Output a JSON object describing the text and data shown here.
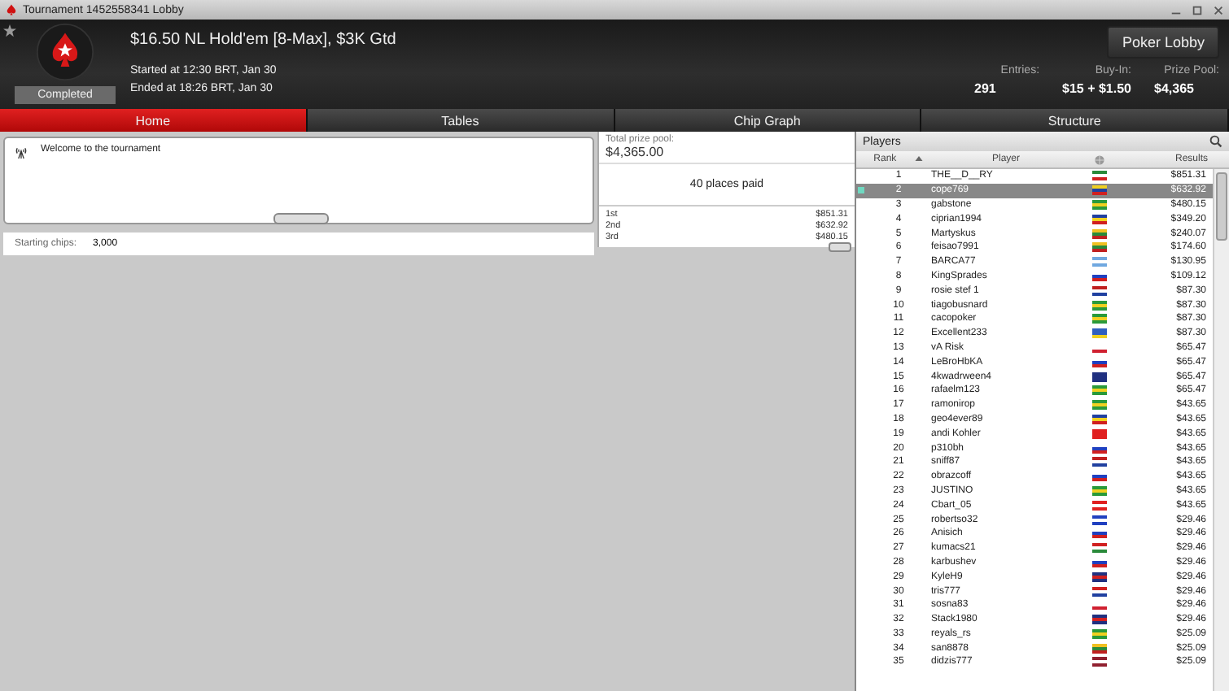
{
  "window": {
    "title": "Tournament 1452558341 Lobby"
  },
  "header": {
    "title": "$16.50 NL Hold'em [8-Max], $3K Gtd",
    "status": "Completed",
    "started": "Started at 12:30 BRT, Jan 30",
    "ended": "Ended at 18:26 BRT, Jan 30",
    "lobby_button": "Poker Lobby",
    "stats": [
      {
        "label": "Entries:",
        "value": "291"
      },
      {
        "label": "Buy-In:",
        "value": "$15 + $1.50"
      },
      {
        "label": "Prize Pool:",
        "value": "$4,365"
      }
    ]
  },
  "tabs": [
    {
      "label": "Home",
      "selected": true
    },
    {
      "label": "Tables",
      "selected": false
    },
    {
      "label": "Chip Graph",
      "selected": false
    },
    {
      "label": "Structure",
      "selected": false
    }
  ],
  "news": {
    "message": "Welcome to the tournament"
  },
  "starting_chips": {
    "label": "Starting chips:",
    "value": "3,000"
  },
  "prizes": {
    "label": "Total prize pool:",
    "total": "$4,365.00",
    "places": "40 places paid",
    "rows": [
      {
        "place": "1st",
        "amount": "$851.31"
      },
      {
        "place": "2nd",
        "amount": "$632.92"
      },
      {
        "place": "3rd",
        "amount": "$480.15"
      }
    ]
  },
  "players": {
    "title": "Players",
    "columns": [
      "Rank",
      "Player",
      "Results"
    ],
    "rows": [
      {
        "rank": "1",
        "name": "THE__D__RY",
        "result": "$851.31",
        "selected": false,
        "flag": [
          {
            "color": "#2a8a3a"
          },
          {
            "color": "#ffffff"
          },
          {
            "color": "#d02020"
          }
        ]
      },
      {
        "rank": "2",
        "name": "cope769",
        "result": "$632.92",
        "selected": true,
        "flag": [
          {
            "color": "#f0d020"
          },
          {
            "color": "#2040a0"
          },
          {
            "color": "#d02020"
          }
        ]
      },
      {
        "rank": "3",
        "name": "gabstone",
        "result": "$480.15",
        "selected": false,
        "flag": [
          {
            "color": "#2a9a3a"
          },
          {
            "color": "#f0d020"
          },
          {
            "color": "#2a9a3a"
          }
        ]
      },
      {
        "rank": "4",
        "name": "ciprian1994",
        "result": "$349.20",
        "selected": false,
        "flag": [
          {
            "color": "#2040a0"
          },
          {
            "color": "#f0d020"
          },
          {
            "color": "#d02020"
          }
        ]
      },
      {
        "rank": "5",
        "name": "Martyskus",
        "result": "$240.07",
        "selected": false,
        "flag": [
          {
            "color": "#f0c020"
          },
          {
            "color": "#2a8a3a"
          },
          {
            "color": "#c02020"
          }
        ]
      },
      {
        "rank": "6",
        "name": "feisao7991",
        "result": "$174.60",
        "selected": false,
        "flag": [
          {
            "color": "#f0c020"
          },
          {
            "color": "#2a8a3a"
          },
          {
            "color": "#c02020"
          }
        ]
      },
      {
        "rank": "7",
        "name": "BARCA77",
        "result": "$130.95",
        "selected": false,
        "flag": [
          {
            "color": "#70a8e0"
          },
          {
            "color": "#ffffff"
          },
          {
            "color": "#70a8e0"
          }
        ]
      },
      {
        "rank": "8",
        "name": "KingSprades",
        "result": "$109.12",
        "selected": false,
        "flag": [
          {
            "color": "#ffffff"
          },
          {
            "color": "#2040c0"
          },
          {
            "color": "#d02020"
          }
        ]
      },
      {
        "rank": "9",
        "name": "rosie stef 1",
        "result": "$87.30",
        "selected": false,
        "flag": [
          {
            "color": "#c02020"
          },
          {
            "color": "#ffffff"
          },
          {
            "color": "#2040a0"
          }
        ]
      },
      {
        "rank": "10",
        "name": "tiagobusnard",
        "result": "$87.30",
        "selected": false,
        "flag": [
          {
            "color": "#2a9a3a"
          },
          {
            "color": "#f0d020"
          },
          {
            "color": "#2a9a3a"
          }
        ]
      },
      {
        "rank": "11",
        "name": "cacopoker",
        "result": "$87.30",
        "selected": false,
        "flag": [
          {
            "color": "#2a9a3a"
          },
          {
            "color": "#f0d020"
          },
          {
            "color": "#2a9a3a"
          }
        ]
      },
      {
        "rank": "12",
        "name": "Excellent233",
        "result": "$87.30",
        "selected": false,
        "flag": [
          {
            "color": "#3060c0"
          },
          {
            "color": "#3060c0"
          },
          {
            "color": "#f0d020"
          }
        ]
      },
      {
        "rank": "13",
        "name": "vA Risk",
        "result": "$65.47",
        "selected": false,
        "flag": [
          {
            "color": "#ffffff"
          },
          {
            "color": "#ffffff"
          },
          {
            "color": "#d02030"
          }
        ]
      },
      {
        "rank": "14",
        "name": "LeBroHbKA",
        "result": "$65.47",
        "selected": false,
        "flag": [
          {
            "color": "#ffffff"
          },
          {
            "color": "#2040c0"
          },
          {
            "color": "#d02020"
          }
        ]
      },
      {
        "rank": "15",
        "name": "4kwadrween4",
        "result": "$65.47",
        "selected": false,
        "flag": [
          {
            "color": "#203080"
          },
          {
            "color": "#203080"
          },
          {
            "color": "#203080"
          }
        ]
      },
      {
        "rank": "16",
        "name": "rafaelm123",
        "result": "$65.47",
        "selected": false,
        "flag": [
          {
            "color": "#2a9a3a"
          },
          {
            "color": "#f0d020"
          },
          {
            "color": "#2a9a3a"
          }
        ]
      },
      {
        "rank": "17",
        "name": "ramonirop",
        "result": "$43.65",
        "selected": false,
        "flag": [
          {
            "color": "#2a9a3a"
          },
          {
            "color": "#f0d020"
          },
          {
            "color": "#2a9a3a"
          }
        ]
      },
      {
        "rank": "18",
        "name": "geo4ever89",
        "result": "$43.65",
        "selected": false,
        "flag": [
          {
            "color": "#2040a0"
          },
          {
            "color": "#f0d020"
          },
          {
            "color": "#d02020"
          }
        ]
      },
      {
        "rank": "19",
        "name": "andi Kohler",
        "result": "$43.65",
        "selected": false,
        "flag": [
          {
            "color": "#e02020"
          },
          {
            "color": "#e02020"
          },
          {
            "color": "#e02020"
          }
        ]
      },
      {
        "rank": "20",
        "name": "p310bh",
        "result": "$43.65",
        "selected": false,
        "flag": [
          {
            "color": "#ffffff"
          },
          {
            "color": "#2040c0"
          },
          {
            "color": "#d02020"
          }
        ]
      },
      {
        "rank": "21",
        "name": "sniff87",
        "result": "$43.65",
        "selected": false,
        "flag": [
          {
            "color": "#c02020"
          },
          {
            "color": "#ffffff"
          },
          {
            "color": "#2040a0"
          }
        ]
      },
      {
        "rank": "22",
        "name": "obrazcoff",
        "result": "$43.65",
        "selected": false,
        "flag": [
          {
            "color": "#ffffff"
          },
          {
            "color": "#2040c0"
          },
          {
            "color": "#d02020"
          }
        ]
      },
      {
        "rank": "23",
        "name": "JUSTINO",
        "result": "$43.65",
        "selected": false,
        "flag": [
          {
            "color": "#2a9a3a"
          },
          {
            "color": "#f0d020"
          },
          {
            "color": "#2a9a3a"
          }
        ]
      },
      {
        "rank": "24",
        "name": "Cbart_05",
        "result": "$43.65",
        "selected": false,
        "flag": [
          {
            "color": "#e02020"
          },
          {
            "color": "#ffffff"
          },
          {
            "color": "#e02020"
          }
        ]
      },
      {
        "rank": "25",
        "name": "robertso32",
        "result": "$29.46",
        "selected": false,
        "flag": [
          {
            "color": "#2040c0"
          },
          {
            "color": "#ffffff"
          },
          {
            "color": "#2040c0"
          }
        ]
      },
      {
        "rank": "26",
        "name": "Anisich",
        "result": "$29.46",
        "selected": false,
        "flag": [
          {
            "color": "#ffffff"
          },
          {
            "color": "#2040c0"
          },
          {
            "color": "#d02020"
          }
        ]
      },
      {
        "rank": "27",
        "name": "kumacs21",
        "result": "$29.46",
        "selected": false,
        "flag": [
          {
            "color": "#d02020"
          },
          {
            "color": "#ffffff"
          },
          {
            "color": "#2a8a3a"
          }
        ]
      },
      {
        "rank": "28",
        "name": "karbushev",
        "result": "$29.46",
        "selected": false,
        "flag": [
          {
            "color": "#ffffff"
          },
          {
            "color": "#2040c0"
          },
          {
            "color": "#d02020"
          }
        ]
      },
      {
        "rank": "29",
        "name": "KyleH9",
        "result": "$29.46",
        "selected": false,
        "flag": [
          {
            "color": "#203080"
          },
          {
            "color": "#d02020"
          },
          {
            "color": "#203080"
          }
        ]
      },
      {
        "rank": "30",
        "name": "tris777",
        "result": "$29.46",
        "selected": false,
        "flag": [
          {
            "color": "#d02020"
          },
          {
            "color": "#ffffff"
          },
          {
            "color": "#2040a0"
          }
        ]
      },
      {
        "rank": "31",
        "name": "sosna83",
        "result": "$29.46",
        "selected": false,
        "flag": [
          {
            "color": "#ffffff"
          },
          {
            "color": "#ffffff"
          },
          {
            "color": "#d02030"
          }
        ]
      },
      {
        "rank": "32",
        "name": "Stack1980",
        "result": "$29.46",
        "selected": false,
        "flag": [
          {
            "color": "#203080"
          },
          {
            "color": "#d02020"
          },
          {
            "color": "#203080"
          }
        ]
      },
      {
        "rank": "33",
        "name": "reyals_rs",
        "result": "$25.09",
        "selected": false,
        "flag": [
          {
            "color": "#2a9a3a"
          },
          {
            "color": "#f0d020"
          },
          {
            "color": "#2a9a3a"
          }
        ]
      },
      {
        "rank": "34",
        "name": "san8878",
        "result": "$25.09",
        "selected": false,
        "flag": [
          {
            "color": "#f0c020"
          },
          {
            "color": "#2a8a3a"
          },
          {
            "color": "#c02020"
          }
        ]
      },
      {
        "rank": "35",
        "name": "didzis777",
        "result": "$25.09",
        "selected": false,
        "flag": [
          {
            "color": "#902030"
          },
          {
            "color": "#ffffff"
          },
          {
            "color": "#902030"
          }
        ]
      }
    ]
  }
}
